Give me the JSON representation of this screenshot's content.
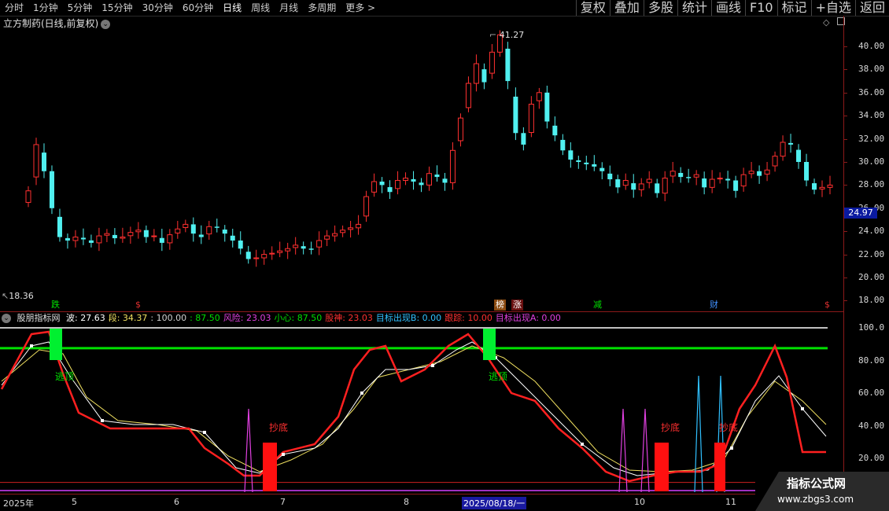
{
  "toolbar": {
    "items": [
      "分时",
      "1分钟",
      "5分钟",
      "15分钟",
      "30分钟",
      "60分钟",
      "日线",
      "周线",
      "月线",
      "多周期",
      "更多 >"
    ],
    "active": "日线",
    "right": [
      "复权",
      "叠加",
      "多股",
      "统计",
      "画线",
      "F10",
      "标记",
      "+自选",
      "返回"
    ]
  },
  "stock": {
    "title": "立方制药(日线,前复权)"
  },
  "price_axis": {
    "ticks": [
      "40.00",
      "38.00",
      "36.00",
      "34.00",
      "32.00",
      "30.00",
      "28.00",
      "26.00",
      "24.00",
      "22.00",
      "20.00",
      "18.00"
    ],
    "current": "24.97",
    "high_label": "41.27",
    "low_label": "18.36"
  },
  "events": [
    {
      "label": "跌",
      "color": "#00e000",
      "bg": "#000"
    },
    {
      "label": "$",
      "color": "#e03030",
      "bg": "#000"
    },
    {
      "label": "榜",
      "color": "#ffffff",
      "bg": "#8a4a10"
    },
    {
      "label": "涨",
      "color": "#ffffff",
      "bg": "#6a1010"
    },
    {
      "label": "减",
      "color": "#00e000",
      "bg": "#000"
    },
    {
      "label": "财",
      "color": "#4090ff",
      "bg": "#000"
    },
    {
      "label": "$",
      "color": "#e03030",
      "bg": "#000"
    }
  ],
  "indicator": {
    "name": "股朋指标网",
    "params": [
      {
        "text": "波: 27.63",
        "color": "#ffffff"
      },
      {
        "text": "段: 34.37",
        "color": "#f0e060"
      },
      {
        "text": ": 100.00",
        "color": "#d0d0d0"
      },
      {
        "text": ": 87.50",
        "color": "#00e000"
      },
      {
        "text": "风险: 23.03",
        "color": "#e040e0"
      },
      {
        "text": "小心: 87.50",
        "color": "#00e000"
      },
      {
        "text": "股神: 23.03",
        "color": "#ff3030"
      },
      {
        "text": "目标出现B: 0.00",
        "color": "#30c0ff"
      },
      {
        "text": "跟踪: 10.00",
        "color": "#ff3030"
      },
      {
        "text": "目标出现A: 0.00",
        "color": "#e040e0"
      }
    ],
    "ticks": [
      "100.0",
      "80.00",
      "60.00",
      "40.00",
      "20.00"
    ],
    "signals": [
      "逃顶",
      "逃顶",
      "抄底",
      "抄底",
      "抄底"
    ]
  },
  "dates": [
    "2025年",
    "5",
    "6",
    "7",
    "8",
    "2025/08/18/一",
    "10",
    "11"
  ],
  "watermark": {
    "line1": "指标公式网",
    "line2": "www.zbgs3.com"
  },
  "colors": {
    "up": "#ff3030",
    "down": "#50f0f0",
    "grid": "#8b1a1a"
  },
  "chart_data": {
    "type": "candlestick",
    "title": "立方制药(日线,前复权)",
    "ylim": [
      18,
      41.27
    ],
    "close_approx": [
      27.5,
      31.5,
      29.2,
      26.0,
      23.5,
      23.2,
      23.5,
      23.3,
      23.0,
      23.6,
      23.8,
      23.4,
      23.5,
      23.9,
      24.1,
      23.5,
      23.6,
      23.0,
      23.7,
      24.2,
      24.6,
      23.8,
      23.5,
      24.4,
      24.3,
      23.8,
      23.2,
      22.5,
      21.6,
      21.7,
      22.0,
      22.1,
      22.3,
      22.5,
      22.8,
      22.5,
      22.4,
      23.2,
      23.6,
      23.8,
      24.1,
      24.3,
      24.6,
      27.0,
      28.3,
      28.0,
      27.4,
      28.4,
      28.6,
      28.3,
      28.0,
      29.0,
      28.7,
      28.2,
      31.0,
      33.8,
      36.8,
      38.5,
      36.9,
      39.5,
      41.0,
      37.0,
      32.5,
      31.5,
      35.0,
      36.0,
      33.5,
      32.3,
      31.0,
      30.2,
      30.0,
      29.8,
      29.6,
      29.2,
      28.5,
      27.8,
      28.4,
      27.6,
      28.1,
      28.5,
      27.3,
      28.6,
      29.2,
      28.7,
      28.6,
      28.9,
      27.8,
      28.5,
      28.6,
      28.4,
      27.5,
      28.9,
      29.2,
      28.8,
      29.3,
      30.5,
      31.7,
      31.5,
      30.0,
      28.4,
      27.6,
      27.8,
      28.0
    ]
  }
}
